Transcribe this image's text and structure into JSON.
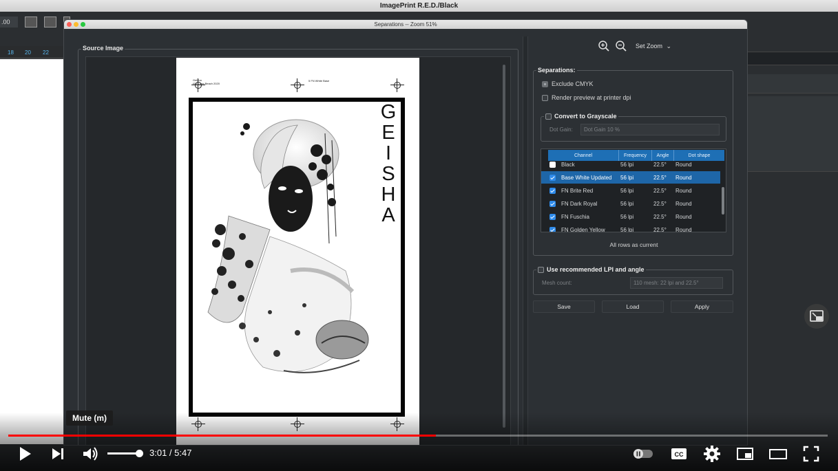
{
  "app": {
    "title": "ImagePrint R.E.D./Black",
    "zoom_field": ".00"
  },
  "ruler": {
    "ticks": [
      "18",
      "20",
      "22"
    ]
  },
  "dialog": {
    "title": "Separations -- Zoom 51%",
    "source_label": "Source Image",
    "set_zoom": "Set Zoom",
    "poster": {
      "meta_left_1": "Geisha",
      "meta_left_2": "ISS Long Beach 2020",
      "meta_center": "5 FN White Base",
      "big_text": "GEISHA"
    },
    "separations": {
      "label": "Separations:",
      "exclude_cmyk": "Exclude CMYK",
      "render_preview": "Render preview at printer dpi",
      "convert_grayscale": "Convert to Grayscale",
      "dot_gain_label": "Dot Gain:",
      "dot_gain_value": "Dot Gain 10 %",
      "columns": {
        "channel": "Channel",
        "frequency": "Frequency",
        "angle": "Angle",
        "dot_shape": "Dot shape"
      },
      "rows": [
        {
          "checked": false,
          "channel": "Black",
          "frequency": "56 lpi",
          "angle": "22.5°",
          "shape": "Round",
          "selected": false
        },
        {
          "checked": true,
          "channel": "Base White Updated",
          "frequency": "56 lpi",
          "angle": "22.5°",
          "shape": "Round",
          "selected": true
        },
        {
          "checked": true,
          "channel": "FN Brite Red",
          "frequency": "56 lpi",
          "angle": "22.5°",
          "shape": "Round",
          "selected": false
        },
        {
          "checked": true,
          "channel": "FN Dark Royal",
          "frequency": "56 lpi",
          "angle": "22.5°",
          "shape": "Round",
          "selected": false
        },
        {
          "checked": true,
          "channel": "FN Fuschia",
          "frequency": "56 lpi",
          "angle": "22.5°",
          "shape": "Round",
          "selected": false
        },
        {
          "checked": true,
          "channel": "FN Golden Yellow",
          "frequency": "56 lpi",
          "angle": "22.5°",
          "shape": "Round",
          "selected": false
        }
      ],
      "all_rows": "All rows as current"
    },
    "lpi": {
      "label": "Use recommended LPI and angle",
      "mesh_label": "Mesh count:",
      "mesh_value": "110 mesh: 22 lpi and 22.5°"
    },
    "buttons": {
      "save": "Save",
      "load": "Load",
      "apply": "Apply"
    }
  },
  "player": {
    "tooltip": "Mute (m)",
    "current_time": "3:01",
    "separator": " / ",
    "duration": "5:47",
    "progress_fraction": 0.522,
    "volume_fraction": 0.9,
    "progress_color": "#ff0000"
  }
}
